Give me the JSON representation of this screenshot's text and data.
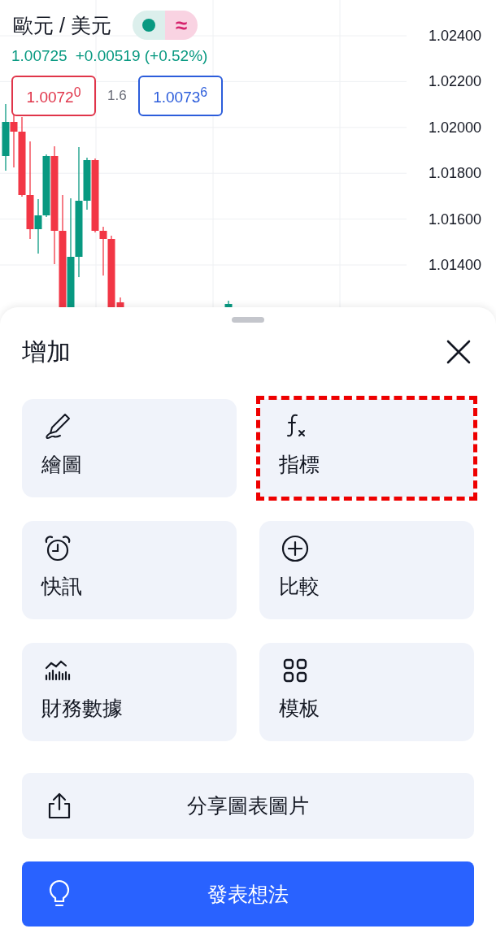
{
  "chart": {
    "symbol": "歐元 / 美元",
    "toggle": {
      "dot_on": true,
      "mark": "≈"
    },
    "last": "1.00725",
    "change": "+0.00519 (+0.52%)",
    "bid": "1.0072$^{0}$",
    "spread": "1.6",
    "ask": "1.0073$^{6}$",
    "price_axis": [
      "1.02400",
      "1.02200",
      "1.02000",
      "1.01800",
      "1.01600",
      "1.01400"
    ]
  },
  "sheet": {
    "title": "增加",
    "items": [
      {
        "label": "繪圖",
        "kind": "pencil",
        "highlighted": false
      },
      {
        "label": "指標",
        "kind": "fx",
        "highlighted": true
      },
      {
        "label": "快訊",
        "kind": "alarm",
        "highlighted": false
      },
      {
        "label": "比較",
        "kind": "plus",
        "highlighted": false
      },
      {
        "label": "財務數據",
        "kind": "bars",
        "highlighted": false
      },
      {
        "label": "模板",
        "kind": "grid",
        "highlighted": false
      }
    ],
    "share": "分享圖表圖片",
    "publish": "發表想法"
  }
}
